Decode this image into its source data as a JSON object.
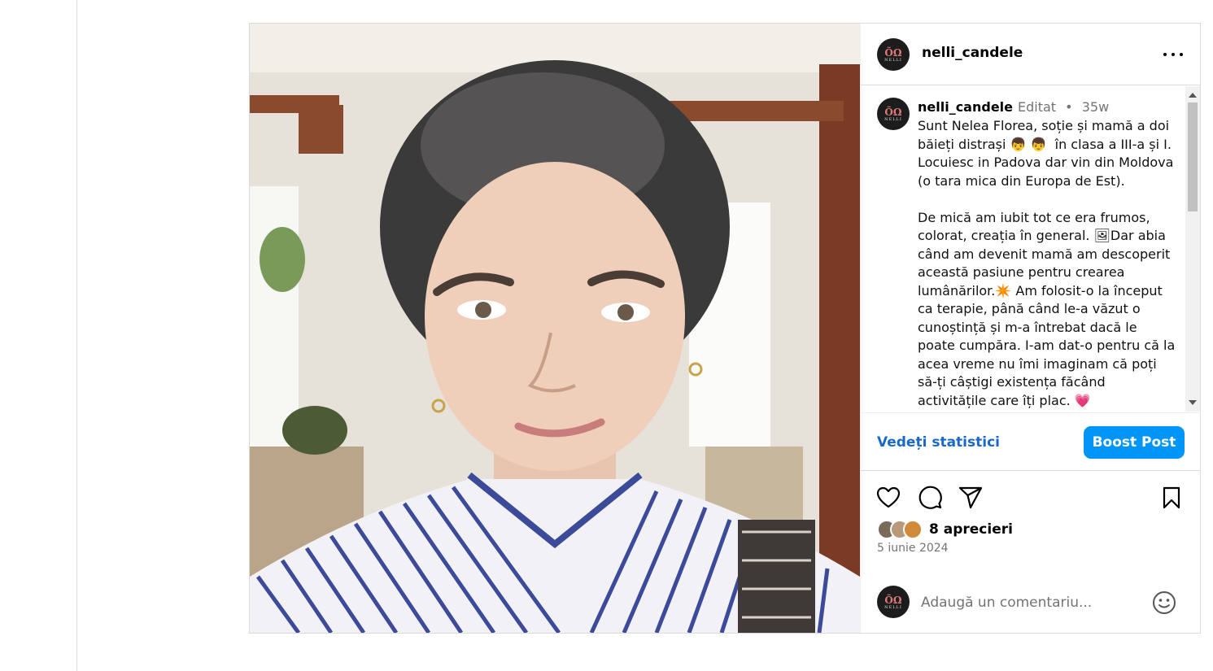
{
  "post": {
    "username": "nelli_candele",
    "avatar_mark": "ÕΩ",
    "avatar_word": "NELLI",
    "edited_label": "Editat",
    "separator": "•",
    "age": "35w",
    "caption": "Sunt Nelea Florea, soție și mamă a doi băieți distrași 👦 👦  în clasa a III-a și I. Locuiesc in Padova dar vin din Moldova (o tara mica din Europa de Est).\n\nDe mică am iubit tot ce era frumos, colorat, creația în general. 🖼Dar abia când am devenit mamă am descoperit această pasiune pentru crearea lumânărilor.✴️ Am folosit-o la început ca terapie, până când le-a văzut o cunoștință și m-a întrebat dacă le poate cumpăra. I-am dat-o pentru că la acea vreme nu îmi imaginam că poți să-ți câștigi existența făcând activitățile care îți plac. 💗",
    "stats_link": "Vedeți statistici",
    "boost_label": "Boost Post",
    "likes": "8 aprecieri",
    "date": "5 iunie 2024",
    "comment_placeholder": "Adaugă un comentariu..."
  },
  "icons": {
    "like": "heart-icon",
    "comment": "comment-icon",
    "share": "share-icon",
    "save": "bookmark-icon",
    "more": "more-options-icon",
    "emoji": "emoji-icon"
  },
  "colors": {
    "accent": "#0095f6",
    "link": "#1a68c8",
    "muted": "#737373"
  }
}
